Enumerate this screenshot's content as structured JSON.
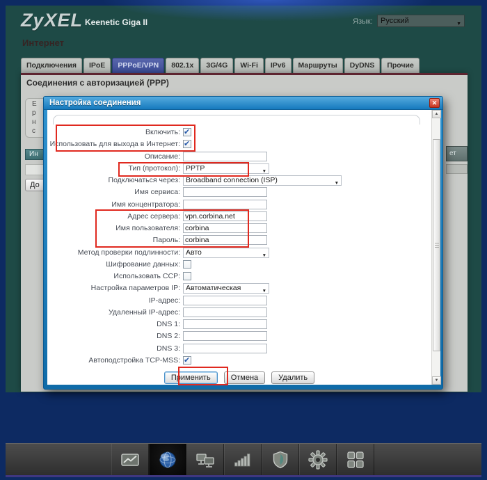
{
  "header": {
    "logo": "ZyXEL",
    "model": "Keenetic Giga II",
    "language_label": "Язык:",
    "language_value": "Русский",
    "page_section": "Интернет"
  },
  "tabs": [
    "Подключения",
    "IPoE",
    "PPPoE/VPN",
    "802.1x",
    "3G/4G",
    "Wi-Fi",
    "IPv6",
    "Маршруты",
    "DyDNS",
    "Прочие"
  ],
  "active_tab": "PPPoE/VPN",
  "panel": {
    "title": "Соединения с авторизацией (PPP)",
    "clipped_text_lines": [
      "Е",
      "р",
      "н",
      "с"
    ],
    "clipped_buttons": {
      "teal": "Ин",
      "bottom_left": "До",
      "right": "ет"
    }
  },
  "dialog": {
    "title": "Настройка соединения",
    "fields": [
      {
        "name": "enable",
        "label": "Включить:",
        "type": "checkbox",
        "checked": true
      },
      {
        "name": "use-for-internet",
        "label": "Использовать для выхода в Интернет:",
        "type": "checkbox",
        "checked": true
      },
      {
        "name": "description",
        "label": "Описание:",
        "type": "text",
        "value": ""
      },
      {
        "name": "protocol",
        "label": "Тип (протокол):",
        "type": "select",
        "value": "PPTP"
      },
      {
        "name": "connect-via",
        "label": "Подключаться через:",
        "type": "select",
        "value": "Broadband connection (ISP)",
        "wide": true
      },
      {
        "name": "service-name",
        "label": "Имя сервиса:",
        "type": "text",
        "value": ""
      },
      {
        "name": "concentrator-name",
        "label": "Имя концентратора:",
        "type": "text",
        "value": ""
      },
      {
        "name": "server-address",
        "label": "Адрес сервера:",
        "type": "text",
        "value": "vpn.corbina.net"
      },
      {
        "name": "username",
        "label": "Имя пользователя:",
        "type": "text",
        "value": "corbina"
      },
      {
        "name": "password",
        "label": "Пароль:",
        "type": "text",
        "value": "corbina"
      },
      {
        "name": "auth-method",
        "label": "Метод проверки подлинности:",
        "type": "select",
        "value": "Авто"
      },
      {
        "name": "encryption",
        "label": "Шифрование данных:",
        "type": "checkbox",
        "checked": false
      },
      {
        "name": "ccp",
        "label": "Использовать CCP:",
        "type": "checkbox",
        "checked": false
      },
      {
        "name": "ip-settings",
        "label": "Настройка параметров IP:",
        "type": "select",
        "value": "Автоматическая"
      },
      {
        "name": "ip-address",
        "label": "IP-адрес:",
        "type": "text",
        "value": ""
      },
      {
        "name": "remote-ip-address",
        "label": "Удаленный IP-адрес:",
        "type": "text",
        "value": ""
      },
      {
        "name": "dns1",
        "label": "DNS 1:",
        "type": "text",
        "value": ""
      },
      {
        "name": "dns2",
        "label": "DNS 2:",
        "type": "text",
        "value": ""
      },
      {
        "name": "dns3",
        "label": "DNS 3:",
        "type": "text",
        "value": ""
      },
      {
        "name": "tcp-mss",
        "label": "Автоподстройка TCP-MSS:",
        "type": "checkbox",
        "checked": true
      }
    ],
    "buttons": [
      {
        "label": "Применить",
        "primary": true,
        "annotated": true
      },
      {
        "label": "Отмена",
        "primary": false
      },
      {
        "label": "Удалить",
        "primary": false
      }
    ]
  },
  "icons": {
    "close": "✕",
    "dropdown_arrow": "▼",
    "scroll_up": "▲",
    "scroll_down": "▼",
    "check": "✔"
  },
  "toolbar": {
    "items": [
      {
        "name": "system-monitor",
        "active": false
      },
      {
        "name": "internet",
        "active": true
      },
      {
        "name": "home-network",
        "active": false
      },
      {
        "name": "wifi",
        "active": false
      },
      {
        "name": "security",
        "active": false
      },
      {
        "name": "system",
        "active": false
      },
      {
        "name": "applications",
        "active": false
      }
    ]
  },
  "colors": {
    "teal_background": "#1e4a46",
    "navy_border": "#0d2a62",
    "dialog_titlebar": "#1579bd",
    "annotation_red": "#e0291f",
    "active_tab_blue": "#45549c",
    "maroon_line": "#5d2430"
  }
}
